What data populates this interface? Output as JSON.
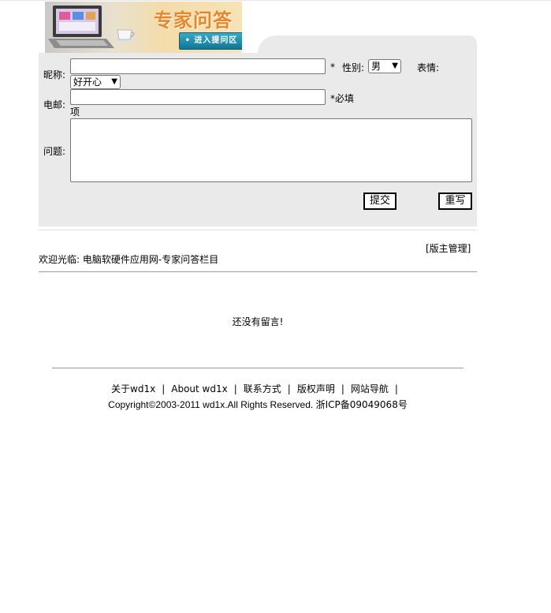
{
  "banner": {
    "title": "专家问答",
    "enter_button": "• 进入提问区"
  },
  "form": {
    "nickname_label": "昵称:",
    "nickname_value": "",
    "required_star": "*",
    "gender_label": "性别:",
    "gender_selected": "男",
    "mood_label": "表情:",
    "mood_selected": "好开心",
    "email_label": "电邮:",
    "email_value": "",
    "email_required_line1": "*必填",
    "email_required_line2": "项",
    "question_label": "问题:",
    "question_value": "",
    "submit_label": "提交",
    "reset_label": "重写"
  },
  "admin_link": "[版主管理]",
  "welcome_text": "欢迎光临: 电脑软硬件应用网-专家问答栏目",
  "empty_message": "还没有留言!",
  "footer": {
    "links": [
      "关于wd1x",
      "About wd1x",
      "联系方式",
      "版权声明",
      "网站导航"
    ],
    "separator": "|",
    "copyright": "Copyright©2003-2011  wd1x.All Rights Reserved.",
    "icp": "浙ICP备09049068号"
  },
  "colors": {
    "panel_bg": "#eaeaea",
    "banner_title": "#e8872a",
    "enter_button": "#1a87a8"
  }
}
